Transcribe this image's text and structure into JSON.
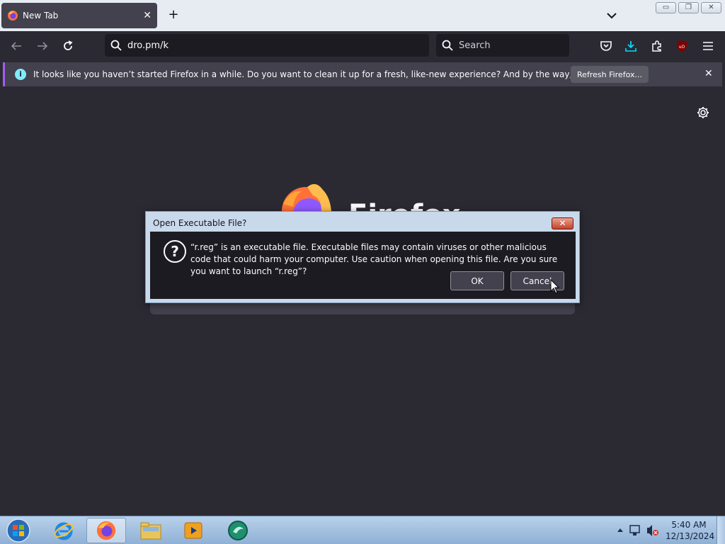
{
  "tab": {
    "title": "New Tab",
    "close": "✕"
  },
  "newtab_label": "+",
  "window_controls": {
    "minimize": "▭",
    "restore": "❐",
    "close": "✕"
  },
  "url": {
    "value": "dro.pm/k"
  },
  "search": {
    "placeholder": "Search"
  },
  "notification": {
    "message": "It looks like you haven’t started Firefox in a while. Do you want to clean it up for a fresh, like-new experience? And by the way, welcome back!",
    "button": "Refresh Firefox...",
    "close": "✕"
  },
  "brand": {
    "wordmark": "Firefox"
  },
  "dialog": {
    "title": "Open Executable File?",
    "close": "✕",
    "message": "“r.reg” is an executable file. Executable files may contain viruses or other malicious code that could harm your computer. Use caution when opening this file. Are you sure you want to launch “r.reg”?",
    "ok": "OK",
    "cancel": "Cancel"
  },
  "taskbar": {
    "clock_time": "5:40 AM",
    "clock_date": "12/13/2024"
  },
  "icons": [
    "firefox-icon",
    "tab-close-icon",
    "new-tab-icon",
    "chevron-down-icon",
    "back-arrow-icon",
    "forward-arrow-icon",
    "reload-icon",
    "search-icon",
    "pocket-icon",
    "download-icon",
    "extensions-icon",
    "ublock-icon",
    "hamburger-menu-icon",
    "info-icon",
    "gear-icon",
    "question-icon"
  ]
}
